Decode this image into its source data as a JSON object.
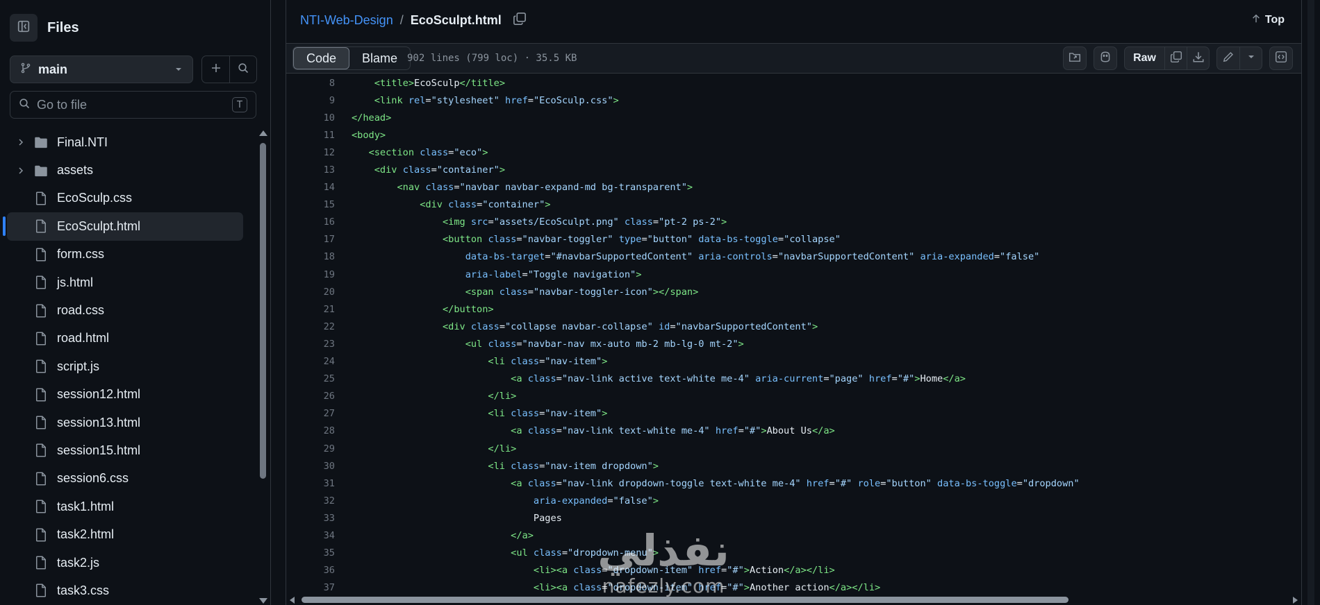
{
  "sidebar": {
    "title": "Files",
    "branch": "main",
    "goto_placeholder": "Go to file",
    "goto_shortcut": "T",
    "items": [
      {
        "name": "Final.NTI",
        "type": "folder"
      },
      {
        "name": "assets",
        "type": "folder"
      },
      {
        "name": "EcoSculp.css",
        "type": "file"
      },
      {
        "name": "EcoSculpt.html",
        "type": "file",
        "active": true
      },
      {
        "name": "form.css",
        "type": "file"
      },
      {
        "name": "js.html",
        "type": "file"
      },
      {
        "name": "road.css",
        "type": "file"
      },
      {
        "name": "road.html",
        "type": "file"
      },
      {
        "name": "script.js",
        "type": "file"
      },
      {
        "name": "session12.html",
        "type": "file"
      },
      {
        "name": "session13.html",
        "type": "file"
      },
      {
        "name": "session15.html",
        "type": "file"
      },
      {
        "name": "session6.css",
        "type": "file"
      },
      {
        "name": "task1.html",
        "type": "file"
      },
      {
        "name": "task2.html",
        "type": "file"
      },
      {
        "name": "task2.js",
        "type": "file"
      },
      {
        "name": "task3.css",
        "type": "file"
      }
    ]
  },
  "header": {
    "repo": "NTI-Web-Design",
    "separator": "/",
    "file": "EcoSculpt.html",
    "top_label": "Top"
  },
  "toolbar": {
    "tab_code": "Code",
    "tab_blame": "Blame",
    "file_info": "902 lines (799 loc) · 35.5 KB",
    "raw_label": "Raw"
  },
  "code_lines": [
    {
      "n": "8",
      "html": "    <span class=tg>&lt;title&gt;</span>EcoSculp<span class=tg>&lt;/title&gt;</span>"
    },
    {
      "n": "9",
      "html": "    <span class=tg>&lt;link</span> <span class=at>rel</span>=<span class=st>\"stylesheet\"</span> <span class=at>href</span>=<span class=st>\"EcoSculp.css\"</span><span class=tg>&gt;</span>"
    },
    {
      "n": "10",
      "html": "<span class=tg>&lt;/head&gt;</span>"
    },
    {
      "n": "11",
      "html": "<span class=tg>&lt;body&gt;</span>"
    },
    {
      "n": "12",
      "html": "   <span class=tg>&lt;section</span> <span class=at>class</span>=<span class=st>\"eco\"</span><span class=tg>&gt;</span>"
    },
    {
      "n": "13",
      "html": "    <span class=tg>&lt;div</span> <span class=at>class</span>=<span class=st>\"container\"</span><span class=tg>&gt;</span>"
    },
    {
      "n": "14",
      "html": "        <span class=tg>&lt;nav</span> <span class=at>class</span>=<span class=st>\"navbar navbar-expand-md bg-transparent\"</span><span class=tg>&gt;</span>"
    },
    {
      "n": "15",
      "html": "            <span class=tg>&lt;div</span> <span class=at>class</span>=<span class=st>\"container\"</span><span class=tg>&gt;</span>"
    },
    {
      "n": "16",
      "html": "                <span class=tg>&lt;img</span> <span class=at>src</span>=<span class=st>\"assets/EcoSculpt.png\"</span> <span class=at>class</span>=<span class=st>\"pt-2 ps-2\"</span><span class=tg>&gt;</span>"
    },
    {
      "n": "17",
      "html": "                <span class=tg>&lt;button</span> <span class=at>class</span>=<span class=st>\"navbar-toggler\"</span> <span class=at>type</span>=<span class=st>\"button\"</span> <span class=at>data-bs-toggle</span>=<span class=st>\"collapse\"</span>"
    },
    {
      "n": "18",
      "html": "                    <span class=at>data-bs-target</span>=<span class=st>\"#navbarSupportedContent\"</span> <span class=at>aria-controls</span>=<span class=st>\"navbarSupportedContent\"</span> <span class=at>aria-expanded</span>=<span class=st>\"false\"</span>"
    },
    {
      "n": "19",
      "html": "                    <span class=at>aria-label</span>=<span class=st>\"Toggle navigation\"</span><span class=tg>&gt;</span>"
    },
    {
      "n": "20",
      "html": "                    <span class=tg>&lt;span</span> <span class=at>class</span>=<span class=st>\"navbar-toggler-icon\"</span><span class=tg>&gt;&lt;/span&gt;</span>"
    },
    {
      "n": "21",
      "html": "                <span class=tg>&lt;/button&gt;</span>"
    },
    {
      "n": "22",
      "html": "                <span class=tg>&lt;div</span> <span class=at>class</span>=<span class=st>\"collapse navbar-collapse\"</span> <span class=at>id</span>=<span class=st>\"navbarSupportedContent\"</span><span class=tg>&gt;</span>"
    },
    {
      "n": "23",
      "html": "                    <span class=tg>&lt;ul</span> <span class=at>class</span>=<span class=st>\"navbar-nav mx-auto mb-2 mb-lg-0 mt-2\"</span><span class=tg>&gt;</span>"
    },
    {
      "n": "24",
      "html": "                        <span class=tg>&lt;li</span> <span class=at>class</span>=<span class=st>\"nav-item\"</span><span class=tg>&gt;</span>"
    },
    {
      "n": "25",
      "html": "                            <span class=tg>&lt;a</span> <span class=at>class</span>=<span class=st>\"nav-link active text-white me-4\"</span> <span class=at>aria-current</span>=<span class=st>\"page\"</span> <span class=at>href</span>=<span class=st>\"#\"</span><span class=tg>&gt;</span>Home<span class=tg>&lt;/a&gt;</span>"
    },
    {
      "n": "26",
      "html": "                        <span class=tg>&lt;/li&gt;</span>"
    },
    {
      "n": "27",
      "html": "                        <span class=tg>&lt;li</span> <span class=at>class</span>=<span class=st>\"nav-item\"</span><span class=tg>&gt;</span>"
    },
    {
      "n": "28",
      "html": "                            <span class=tg>&lt;a</span> <span class=at>class</span>=<span class=st>\"nav-link text-white me-4\"</span> <span class=at>href</span>=<span class=st>\"#\"</span><span class=tg>&gt;</span>About Us<span class=tg>&lt;/a&gt;</span>"
    },
    {
      "n": "29",
      "html": "                        <span class=tg>&lt;/li&gt;</span>"
    },
    {
      "n": "30",
      "html": "                        <span class=tg>&lt;li</span> <span class=at>class</span>=<span class=st>\"nav-item dropdown\"</span><span class=tg>&gt;</span>"
    },
    {
      "n": "31",
      "html": "                            <span class=tg>&lt;a</span> <span class=at>class</span>=<span class=st>\"nav-link dropdown-toggle text-white me-4\"</span> <span class=at>href</span>=<span class=st>\"#\"</span> <span class=at>role</span>=<span class=st>\"button\"</span> <span class=at>data-bs-toggle</span>=<span class=st>\"dropdown\"</span>"
    },
    {
      "n": "32",
      "html": "                                <span class=at>aria-expanded</span>=<span class=st>\"false\"</span><span class=tg>&gt;</span>"
    },
    {
      "n": "33",
      "html": "                                Pages"
    },
    {
      "n": "34",
      "html": "                            <span class=tg>&lt;/a&gt;</span>"
    },
    {
      "n": "35",
      "html": "                            <span class=tg>&lt;ul</span> <span class=at>class</span>=<span class=st>\"dropdown-menu\"</span><span class=tg>&gt;</span>"
    },
    {
      "n": "36",
      "html": "                                <span class=tg>&lt;li&gt;&lt;a</span> <span class=at>class</span>=<span class=st>\"dropdown-item\"</span> <span class=at>href</span>=<span class=st>\"#\"</span><span class=tg>&gt;</span>Action<span class=tg>&lt;/a&gt;&lt;/li&gt;</span>"
    },
    {
      "n": "37",
      "html": "                                <span class=tg>&lt;li&gt;&lt;a</span> <span class=at>class</span>=<span class=st>\"dropdown-item\"</span> <span class=at>href</span>=<span class=st>\"#\"</span><span class=tg>&gt;</span>Another action<span class=tg>&lt;/a&gt;&lt;/li&gt;</span>"
    }
  ],
  "watermark": {
    "arabic": "نفذلي",
    "latin": "nafezly.com"
  }
}
